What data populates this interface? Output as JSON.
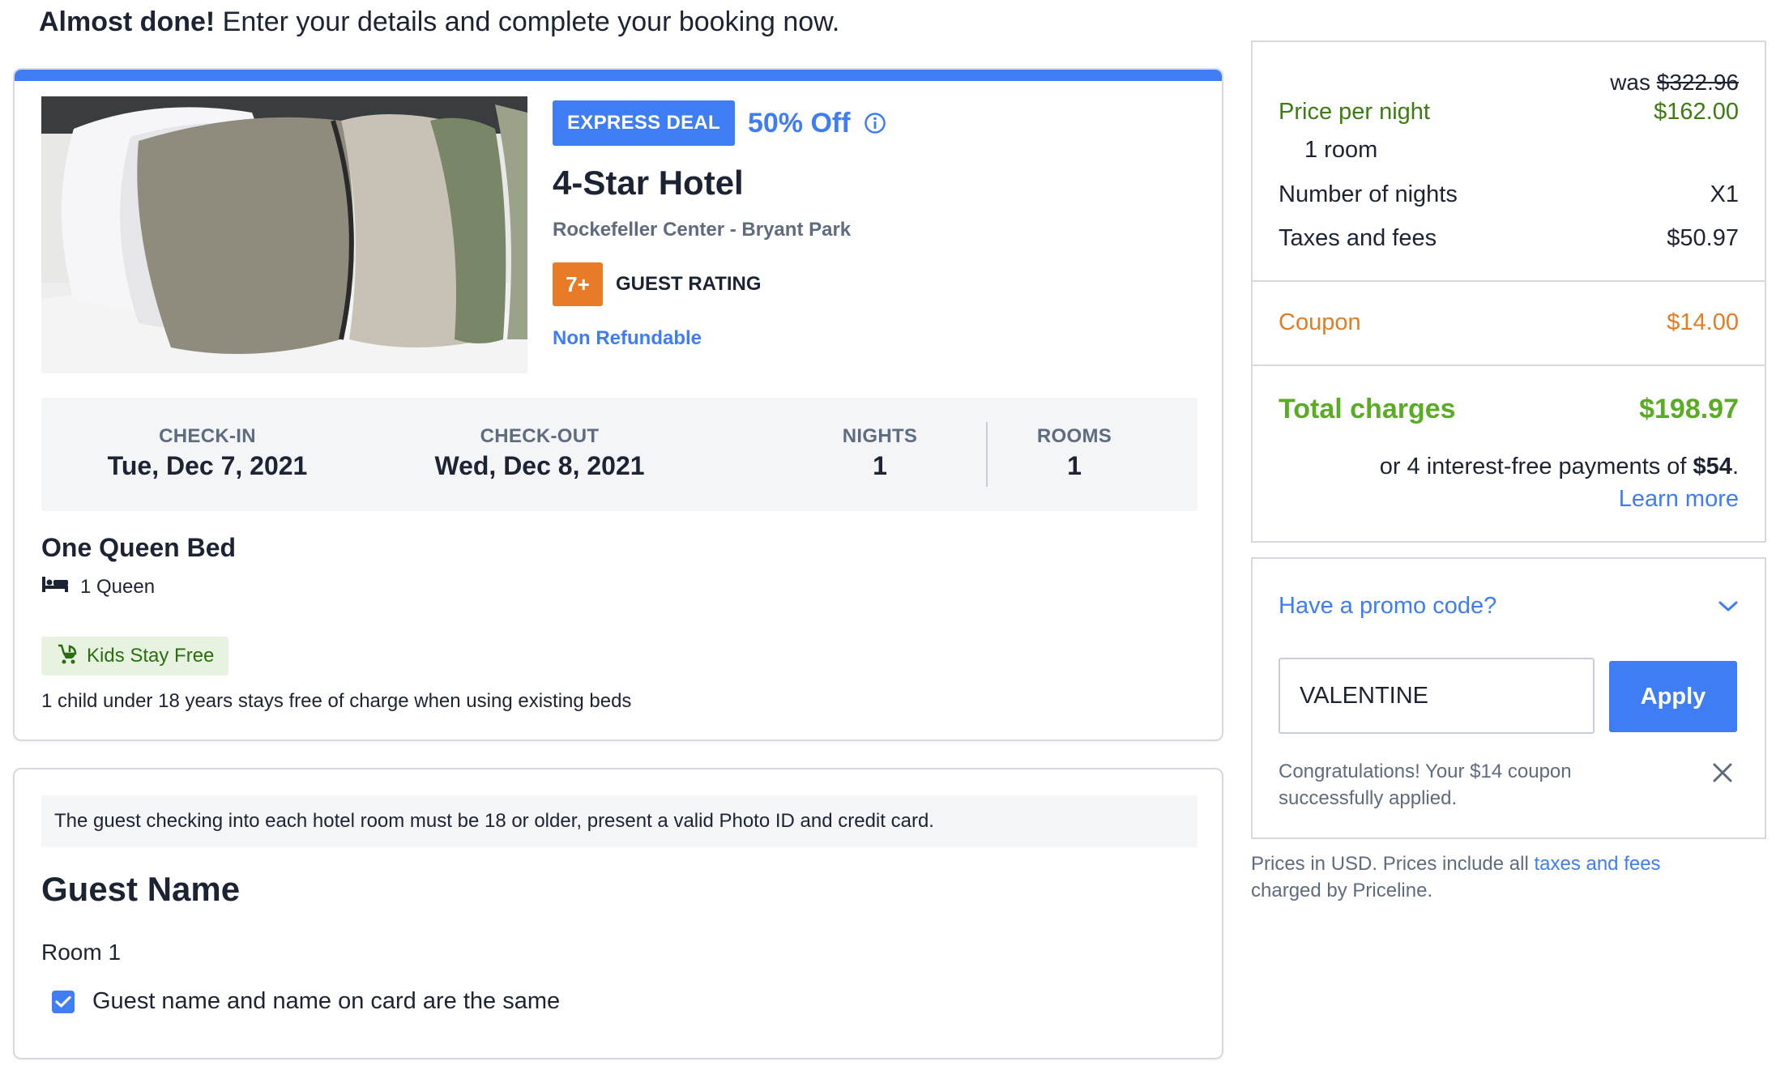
{
  "header": {
    "bold_text": "Almost done!",
    "text": " Enter your details and complete your booking now."
  },
  "hotel": {
    "image_alt": "hotel-bed-pillows-photo",
    "deal_badge": "EXPRESS DEAL",
    "discount": "50% Off",
    "name": "4-Star Hotel",
    "location": "Rockefeller Center - Bryant Park",
    "rating_value": "7+",
    "rating_label": "GUEST RATING",
    "refund_policy": "Non Refundable"
  },
  "stay": {
    "checkin_label": "CHECK-IN",
    "checkin_value": "Tue, Dec 7, 2021",
    "checkout_label": "CHECK-OUT",
    "checkout_value": "Wed, Dec 8, 2021",
    "nights_label": "NIGHTS",
    "nights_value": "1",
    "rooms_label": "ROOMS",
    "rooms_value": "1"
  },
  "room": {
    "type": "One Queen Bed",
    "beds": "1 Queen",
    "kids_badge": "Kids Stay Free",
    "kids_note": "1 child under 18 years stays free of charge when using existing beds"
  },
  "guest": {
    "notice": "The guest checking into each hotel room must be 18 or older, present a valid Photo ID and credit card.",
    "title": "Guest Name",
    "room_label": "Room 1",
    "same_name_label": "Guest name and name on card are the same",
    "same_name_checked": true
  },
  "summary": {
    "was_label": "was",
    "was_price": "$322.96",
    "price_per_night_label": "Price per night",
    "price_per_night": "$162.00",
    "rooms_note": "1 room",
    "nights_label": "Number of nights",
    "nights_value": "X1",
    "taxes_label": "Taxes and fees",
    "taxes_value": "$50.97",
    "coupon_label": "Coupon",
    "coupon_value": "$14.00",
    "total_label": "Total charges",
    "total_value": "$198.97",
    "installment_text": "or 4 interest-free payments of ",
    "installment_amount": "$54",
    "installment_end": ".",
    "learn_more": "Learn more"
  },
  "promo": {
    "heading": "Have a promo code?",
    "code_value": "VALENTINE",
    "apply_label": "Apply",
    "success_message": "Congratulations! Your $14 coupon successfully applied."
  },
  "footnote": {
    "prefix": "Prices in USD. Prices include all ",
    "link": "taxes and fees",
    "suffix": " charged by Priceline."
  },
  "colors": {
    "accent": "#3e7df3",
    "rating": "#e87b25",
    "total_green": "#5aac24",
    "price_green": "#3b7d10",
    "coupon_orange": "#e27d25"
  }
}
